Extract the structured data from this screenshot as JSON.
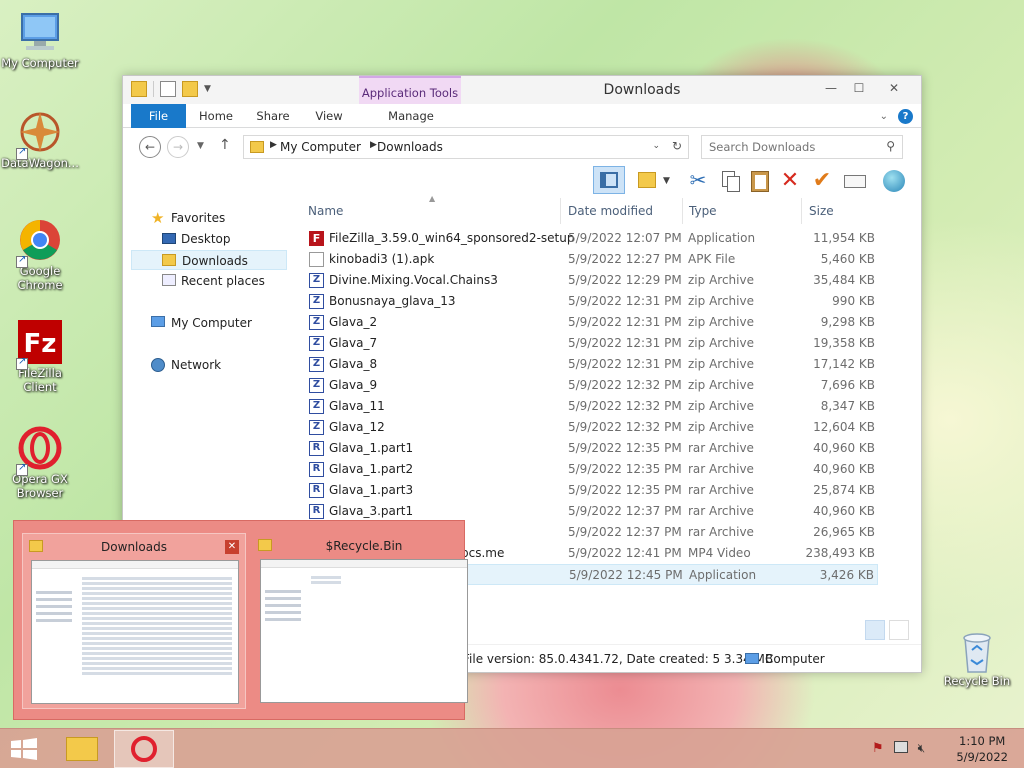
{
  "desktop": {
    "icons": [
      {
        "label": "My Computer"
      },
      {
        "label": "DataWagon..."
      },
      {
        "label": "Google Chrome"
      },
      {
        "label": "FileZilla Client"
      },
      {
        "label": "Opera GX Browser"
      }
    ],
    "recycle_bin": "Recycle Bin"
  },
  "window": {
    "title": "Downloads",
    "context_tab_header": "Application Tools",
    "ribbon_tabs": {
      "file": "File",
      "home": "Home",
      "share": "Share",
      "view": "View",
      "manage": "Manage"
    },
    "breadcrumb": [
      "My Computer",
      "Downloads"
    ],
    "search_placeholder": "Search Downloads",
    "nav": {
      "favorites": "Favorites",
      "desktop": "Desktop",
      "downloads": "Downloads",
      "recent": "Recent places",
      "computer": "My Computer",
      "network": "Network"
    },
    "columns": {
      "name": "Name",
      "date": "Date modified",
      "type": "Type",
      "size": "Size"
    },
    "files": [
      {
        "name": "FileZilla_3.59.0_win64_sponsored2-setup",
        "date": "5/9/2022 12:07 PM",
        "type": "Application",
        "size": "11,954 KB",
        "icon": "filezilla"
      },
      {
        "name": "kinobadi3 (1).apk",
        "date": "5/9/2022 12:27 PM",
        "type": "APK File",
        "size": "5,460 KB",
        "icon": "apk"
      },
      {
        "name": "Divine.Mixing.Vocal.Chains3",
        "date": "5/9/2022 12:29 PM",
        "type": "zip Archive",
        "size": "35,484 KB",
        "icon": "zip"
      },
      {
        "name": "Bonusnaya_glava_13",
        "date": "5/9/2022 12:31 PM",
        "type": "zip Archive",
        "size": "990 KB",
        "icon": "zip"
      },
      {
        "name": "Glava_2",
        "date": "5/9/2022 12:31 PM",
        "type": "zip Archive",
        "size": "9,298 KB",
        "icon": "zip"
      },
      {
        "name": "Glava_7",
        "date": "5/9/2022 12:31 PM",
        "type": "zip Archive",
        "size": "19,358 KB",
        "icon": "zip"
      },
      {
        "name": "Glava_8",
        "date": "5/9/2022 12:31 PM",
        "type": "zip Archive",
        "size": "17,142 KB",
        "icon": "zip"
      },
      {
        "name": "Glava_9",
        "date": "5/9/2022 12:32 PM",
        "type": "zip Archive",
        "size": "7,696 KB",
        "icon": "zip"
      },
      {
        "name": "Glava_11",
        "date": "5/9/2022 12:32 PM",
        "type": "zip Archive",
        "size": "8,347 KB",
        "icon": "zip"
      },
      {
        "name": "Glava_12",
        "date": "5/9/2022 12:32 PM",
        "type": "zip Archive",
        "size": "12,604 KB",
        "icon": "zip"
      },
      {
        "name": "Glava_1.part1",
        "date": "5/9/2022 12:35 PM",
        "type": "rar Archive",
        "size": "40,960 KB",
        "icon": "rar"
      },
      {
        "name": "Glava_1.part2",
        "date": "5/9/2022 12:35 PM",
        "type": "rar Archive",
        "size": "40,960 KB",
        "icon": "rar"
      },
      {
        "name": "Glava_1.part3",
        "date": "5/9/2022 12:35 PM",
        "type": "rar Archive",
        "size": "25,874 KB",
        "icon": "rar"
      },
      {
        "name": "Glava_3.part1",
        "date": "5/9/2022 12:37 PM",
        "type": "rar Archive",
        "size": "40,960 KB",
        "icon": "rar"
      },
      {
        "name": "",
        "date": "5/9/2022 12:37 PM",
        "type": "rar Archive",
        "size": "26,965 KB",
        "icon": "rar"
      },
      {
        "name": "pcs.me",
        "date": "5/9/2022 12:41 PM",
        "type": "MP4 Video",
        "size": "238,493 KB",
        "icon": "mp4"
      },
      {
        "name": "",
        "date": "5/9/2022 12:45 PM",
        "type": "Application",
        "size": "3,426 KB",
        "icon": "app"
      }
    ],
    "status_file": "File version: 85.0.4341.72, Date created: 5",
    "status_size": "3.34 MB",
    "status_computer": "Computer"
  },
  "thumbs": [
    {
      "title": "Downloads"
    },
    {
      "title": "$Recycle.Bin"
    }
  ],
  "taskbar": {
    "time": "1:10 PM",
    "date": "5/9/2022"
  },
  "colors": {
    "accent_blue": "#1979ca",
    "app_tools_bg": "#f1d9f4",
    "thumb_popup": "#ec8b85",
    "taskbar": "#d8a294"
  }
}
